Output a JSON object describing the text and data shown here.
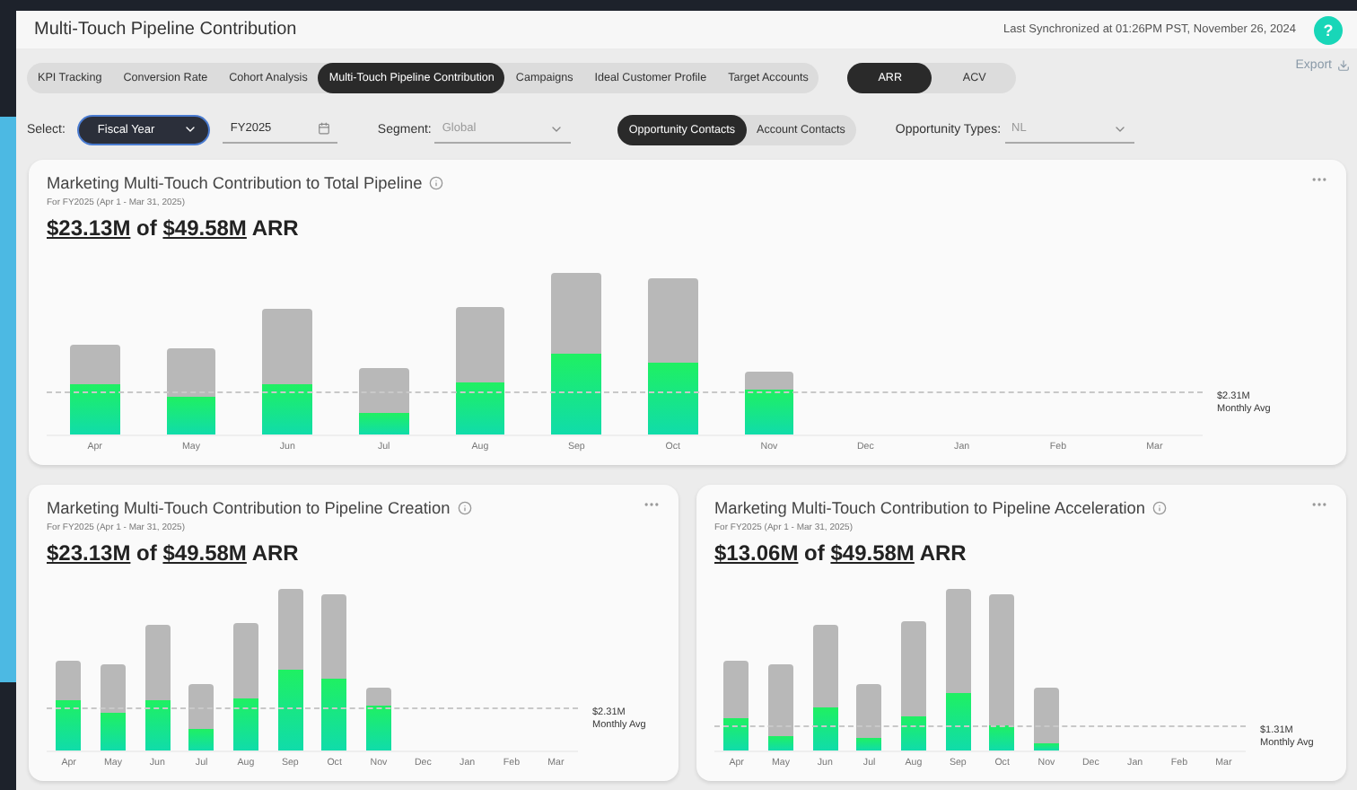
{
  "header": {
    "title": "Multi-Touch Pipeline Contribution",
    "sync_text": "Last Synchronized at 01:26PM PST, November 26, 2024",
    "help": "?"
  },
  "tabs": [
    {
      "label": "KPI Tracking",
      "selected": false
    },
    {
      "label": "Conversion Rate",
      "selected": false
    },
    {
      "label": "Cohort Analysis",
      "selected": false
    },
    {
      "label": "Multi-Touch Pipeline Contribution",
      "selected": true
    },
    {
      "label": "Campaigns",
      "selected": false
    },
    {
      "label": "Ideal Customer Profile",
      "selected": false
    },
    {
      "label": "Target Accounts",
      "selected": false
    }
  ],
  "metric_toggle": [
    {
      "label": "ARR",
      "selected": true
    },
    {
      "label": "ACV",
      "selected": false
    }
  ],
  "export": "Export",
  "filters": {
    "select_label": "Select:",
    "period_type": "Fiscal Year",
    "period_value": "FY2025",
    "segment_label": "Segment:",
    "segment_value": "Global",
    "types_label": "Opportunity Types:",
    "types_value": "NL"
  },
  "contact_toggle": [
    {
      "label": "Opportunity Contacts",
      "selected": true
    },
    {
      "label": "Account Contacts",
      "selected": false
    }
  ],
  "cards": [
    {
      "title": "Marketing Multi-Touch Contribution to Total Pipeline",
      "subtitle": "For FY2025 (Apr 1 - Mar 31, 2025)",
      "headline": {
        "amount": "$23.13M",
        "joiner": "of",
        "total": "$49.58M",
        "unit": "ARR"
      },
      "avg_value": "$2.31M",
      "avg_label": "Monthly Avg",
      "months": [
        "Apr",
        "May",
        "Jun",
        "Jul",
        "Aug",
        "Sep",
        "Oct",
        "Nov",
        "Dec",
        "Jan",
        "Feb",
        "Mar"
      ]
    },
    {
      "title": "Marketing Multi-Touch Contribution to Pipeline Creation",
      "subtitle": "For FY2025 (Apr 1 - Mar 31, 2025)",
      "headline": {
        "amount": "$23.13M",
        "joiner": "of",
        "total": "$49.58M",
        "unit": "ARR"
      },
      "avg_value": "$2.31M",
      "avg_label": "Monthly Avg",
      "months": [
        "Apr",
        "May",
        "Jun",
        "Jul",
        "Aug",
        "Sep",
        "Oct",
        "Nov",
        "Dec",
        "Jan",
        "Feb",
        "Mar"
      ]
    },
    {
      "title": "Marketing Multi-Touch Contribution to Pipeline Acceleration",
      "subtitle": "For FY2025 (Apr 1 - Mar 31, 2025)",
      "headline": {
        "amount": "$13.06M",
        "joiner": "of",
        "total": "$49.58M",
        "unit": "ARR"
      },
      "avg_value": "$1.31M",
      "avg_label": "Monthly Avg",
      "months": [
        "Apr",
        "May",
        "Jun",
        "Jul",
        "Aug",
        "Sep",
        "Oct",
        "Nov",
        "Dec",
        "Jan",
        "Feb",
        "Mar"
      ]
    }
  ]
}
